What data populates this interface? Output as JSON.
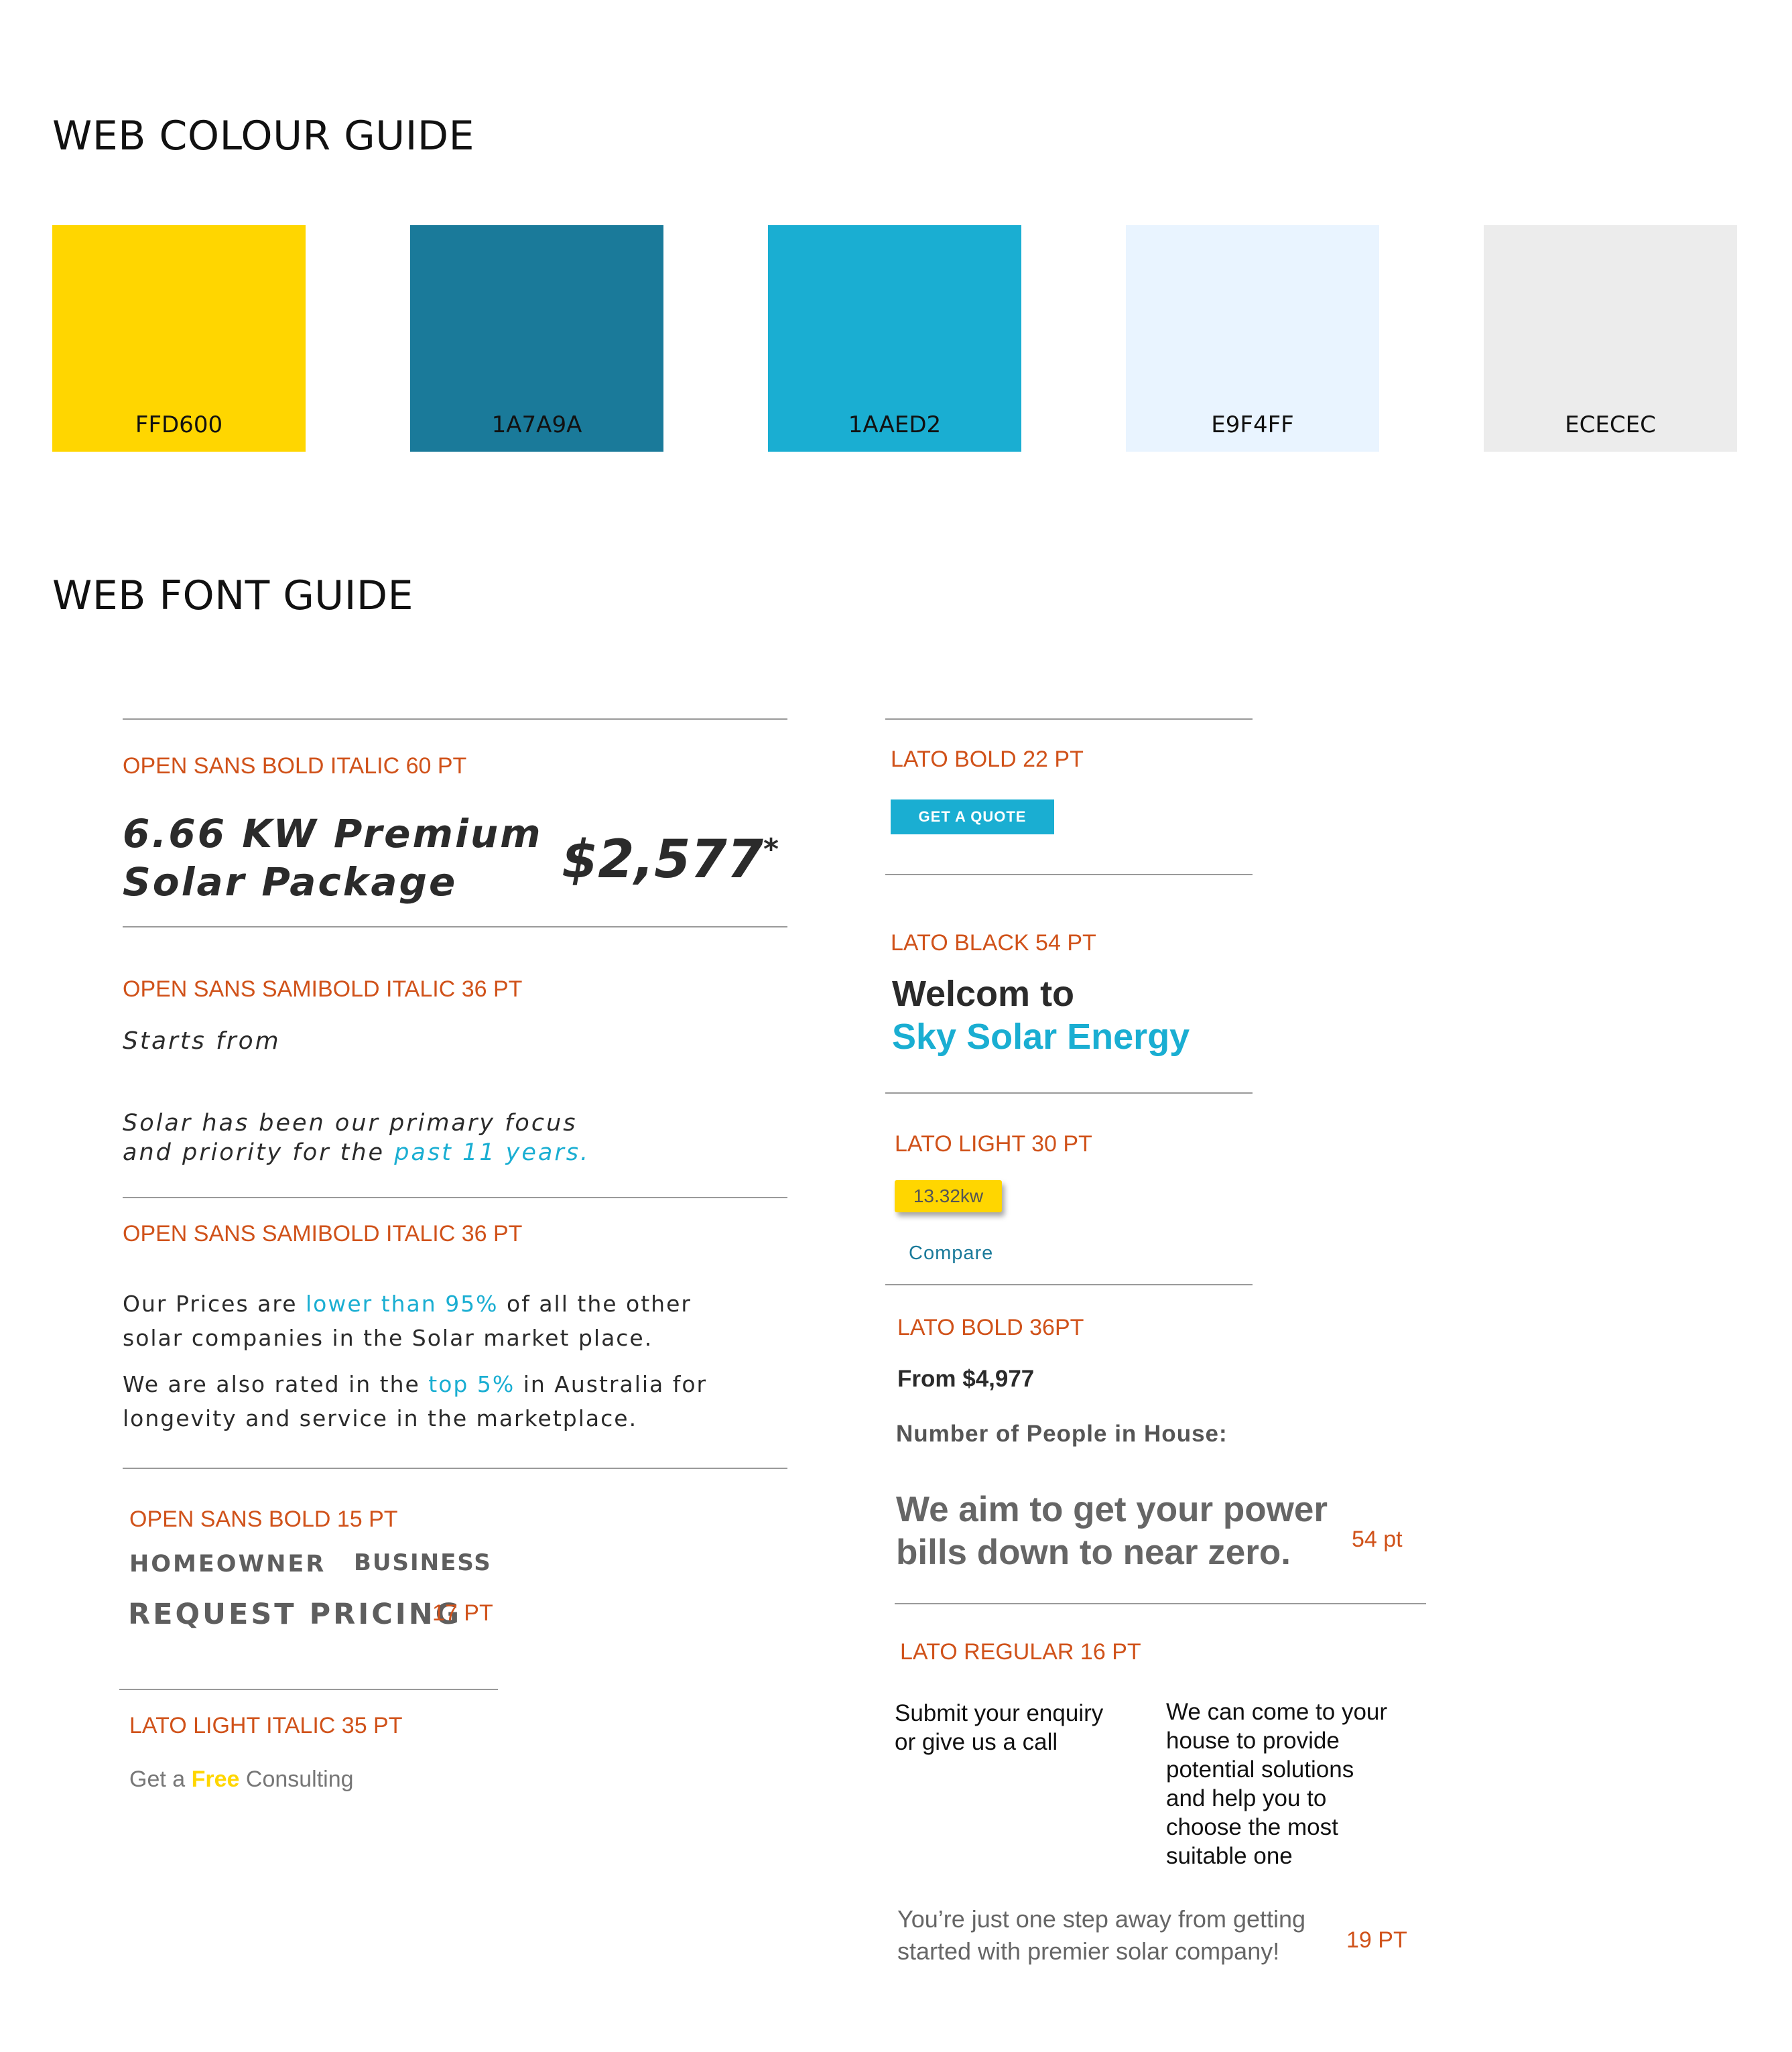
{
  "colour_guide": {
    "title": "WEB COLOUR GUIDE",
    "swatches": [
      {
        "hex": "FFD600",
        "color": "#FFD600"
      },
      {
        "hex": "1A7A9A",
        "color": "#1A7A9A"
      },
      {
        "hex": "1AAED2",
        "color": "#1AAED2"
      },
      {
        "hex": "E9F4FF",
        "color": "#E9F4FF"
      },
      {
        "hex": "ECECEC",
        "color": "#ECECEC"
      }
    ]
  },
  "font_guide": {
    "title": "WEB FONT GUIDE",
    "left": {
      "s1_label": "OPEN SANS BOLD ITALIC   60 PT",
      "s1_line1": "6.66 KW Premium",
      "s1_line2": "Solar Package",
      "s1_price": "$2,577",
      "s1_star": "*",
      "s2_label": "OPEN SANS SAMIBOLD ITALIC   36 PT",
      "s2_starts": "Starts from",
      "s2_line1": "Solar has been our primary focus",
      "s2_line2a": "and priority for the ",
      "s2_line2b": "past 11 years.",
      "s3_label": "OPEN SANS SAMIBOLD ITALIC   36 PT",
      "s3_p1a": "Our Prices are ",
      "s3_p1b": "lower than 95%",
      "s3_p1c": " of all the other",
      "s3_p1d": "solar companies in the Solar market place.",
      "s3_p2a": "We are also rated in the ",
      "s3_p2b": "top 5%",
      "s3_p2c": " in Australia for",
      "s3_p2d": "longevity and service in the marketplace.",
      "s4_label": "OPEN SANS BOLD  15 PT",
      "s4_homeowner": "HOMEOWNER",
      "s4_business": "BUSINESS",
      "s4_request": "REQUEST PRICING",
      "s4_17pt": "17 PT",
      "s5_label": "LATO LIGHT ITALIC 35 PT",
      "s5_a": "Get a ",
      "s5_b": "Free",
      "s5_c": " Consulting"
    },
    "right": {
      "r1_label": "LATO BOLD 22 PT",
      "r1_button": "GET A QUOTE",
      "r2_label": "LATO BLACK   54 PT",
      "r2_line1": "Welcom to",
      "r2_line2": "Sky Solar Energy",
      "r3_label": "LATO LIGHT 30 PT",
      "r3_tag": "13.32kw",
      "r3_compare": "Compare",
      "r4_label": "LATO BOLD 36PT",
      "r4_from": "From $4,977",
      "r4_people": "Number of People in House:",
      "r4_aim1": "We aim to get your power",
      "r4_aim2": "bills down to near zero.",
      "r4_54pt": "54 pt",
      "r5_label": "LATO REGULAR  16 PT",
      "r5_c1l1": "Submit your enquiry",
      "r5_c1l2": "or give us a call",
      "r5_c2": [
        "We can come to your",
        "house to provide",
        "potential solutions",
        "and help you to",
        "choose the most",
        "suitable one"
      ],
      "r5_bot1": "You’re just one step away from getting",
      "r5_bot2": "started with premier solar company!",
      "r5_19pt": "19 PT"
    }
  }
}
